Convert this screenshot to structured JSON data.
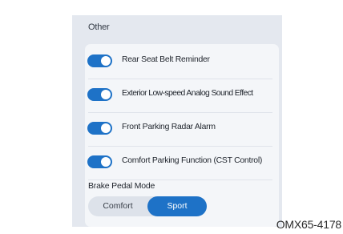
{
  "section": {
    "title": "Other"
  },
  "toggles": [
    {
      "label": "Rear Seat Belt Reminder",
      "on": true
    },
    {
      "label": "Exterior Low-speed Analog Sound Effect",
      "on": true
    },
    {
      "label": "Front Parking Radar Alarm",
      "on": true
    },
    {
      "label": "Comfort Parking Function (CST Control)",
      "on": true
    }
  ],
  "brake_pedal": {
    "title": "Brake Pedal Mode",
    "options": [
      "Comfort",
      "Sport"
    ],
    "selected": "Sport"
  },
  "figure_code": "OMX65-4178",
  "colors": {
    "accent": "#1e72c7",
    "panel_background": "#e4e8ef",
    "card_background": "#f4f6f9"
  }
}
